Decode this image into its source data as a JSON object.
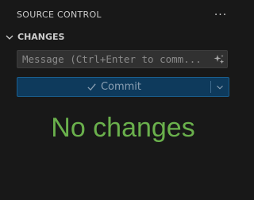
{
  "header": {
    "title": "SOURCE CONTROL",
    "more_icon": "ellipsis-icon"
  },
  "section": {
    "title": "CHANGES",
    "chevron_icon": "chevron-down-icon"
  },
  "message": {
    "placeholder": "Message (Ctrl+Enter to comm...",
    "value": "",
    "sparkle_icon": "sparkle-icon"
  },
  "commit": {
    "label": "Commit",
    "check_icon": "check-icon",
    "dropdown_icon": "chevron-down-icon"
  },
  "empty_state": {
    "text": "No changes"
  },
  "colors": {
    "background": "#181818",
    "commit_bg": "#0e3a5c",
    "empty_text": "#6ab04c"
  }
}
